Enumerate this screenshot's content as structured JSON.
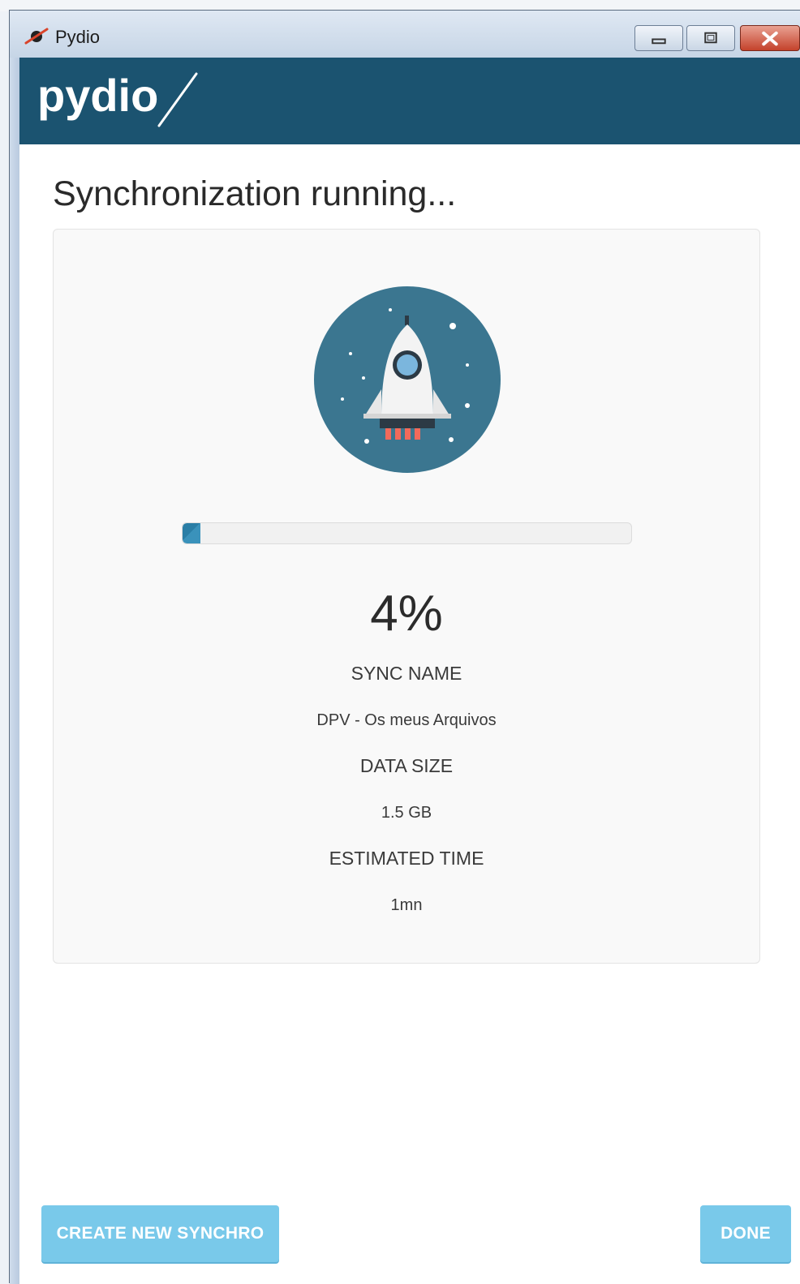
{
  "window": {
    "title": "Pydio"
  },
  "header": {
    "logo_text": "pydio"
  },
  "main": {
    "heading": "Synchronization running...",
    "progress": {
      "percent_value": 4,
      "percent_label": "4%"
    },
    "details": [
      {
        "label": "SYNC NAME",
        "value": "DPV - Os meus Arquivos"
      },
      {
        "label": "DATA SIZE",
        "value": "1.5 GB"
      },
      {
        "label": "ESTIMATED TIME",
        "value": "1mn"
      }
    ]
  },
  "footer": {
    "create_label": "CREATE NEW SYNCHRO",
    "done_label": "DONE"
  },
  "colors": {
    "header_bg": "#1b5370",
    "accent_button": "#79c9ea",
    "progress_fill": "#2a7ea6",
    "rocket_circle": "#3b7690"
  },
  "icons": [
    "pydio-app-icon",
    "minimize-icon",
    "maximize-icon",
    "close-icon",
    "rocket-icon"
  ]
}
